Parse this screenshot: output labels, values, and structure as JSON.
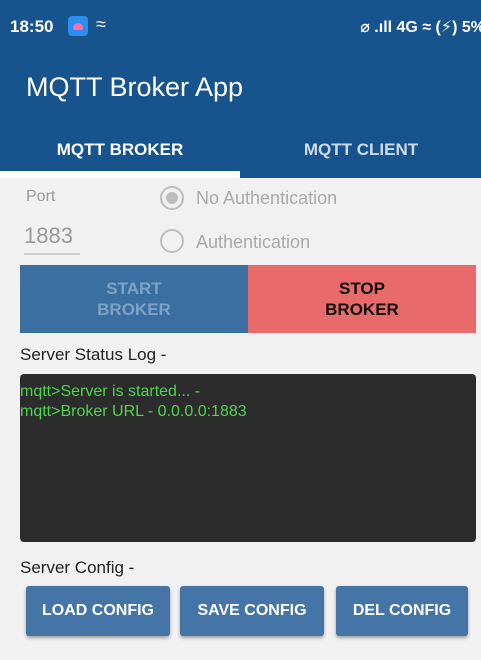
{
  "status_bar": {
    "time": "18:50",
    "right": "⌀ .ıll 4G ≈ (⚡) 5%"
  },
  "app": {
    "title": "MQTT Broker App"
  },
  "tabs": [
    {
      "label": "MQTT BROKER",
      "selected": true
    },
    {
      "label": "MQTT CLIENT",
      "selected": false
    }
  ],
  "settings": {
    "port_label": "Port",
    "port_value": "1883",
    "auth_options": [
      {
        "label": "No Authentication",
        "selected": true
      },
      {
        "label": "Authentication",
        "selected": false
      }
    ]
  },
  "controls": {
    "start_label": "START BROKER",
    "stop_label": "STOP BROKER"
  },
  "log": {
    "label": "Server Status Log -",
    "lines": [
      "mqtt>Server is started... -",
      "mqtt>Broker URL - 0.0.0.0:1883"
    ]
  },
  "config": {
    "label": "Server Config -",
    "buttons": [
      "LOAD CONFIG",
      "SAVE CONFIG",
      "DEL CONFIG"
    ]
  },
  "colors": {
    "primary": "#17538c",
    "stop_button": "#e96a6a",
    "log_background": "#2c2c2c",
    "log_text": "#4cd54c"
  }
}
